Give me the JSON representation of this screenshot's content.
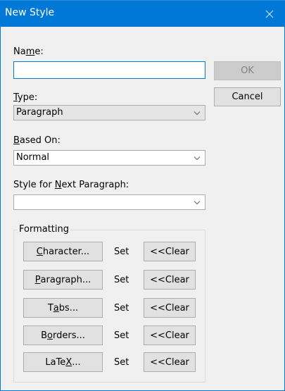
{
  "window": {
    "title": "New Style",
    "close_icon": "close-icon"
  },
  "name": {
    "label_pre": "Na",
    "label_accel": "m",
    "label_post": "e:",
    "value": ""
  },
  "type": {
    "label_pre": "",
    "label_accel": "T",
    "label_post": "ype:",
    "value": "Paragraph"
  },
  "based_on": {
    "label_pre": "",
    "label_accel": "B",
    "label_post": "ased On:",
    "value": "Normal"
  },
  "next_paragraph": {
    "label_pre": "Style for ",
    "label_accel": "N",
    "label_post": "ext Paragraph:",
    "value": ""
  },
  "buttons": {
    "ok": "OK",
    "cancel": "Cancel"
  },
  "formatting": {
    "legend": "Formatting",
    "set_label": "Set",
    "clear_label": "<<Clear",
    "rows": [
      {
        "pre": "",
        "accel": "C",
        "post": "haracter..."
      },
      {
        "pre": "",
        "accel": "P",
        "post": "aragraph..."
      },
      {
        "pre": "T",
        "accel": "a",
        "post": "bs..."
      },
      {
        "pre": "B",
        "accel": "o",
        "post": "rders..."
      },
      {
        "pre": "LaTe",
        "accel": "X",
        "post": "..."
      }
    ]
  },
  "colors": {
    "accent": "#0078d7",
    "dialog_bg": "#f0f0f0",
    "button_bg": "#e1e1e1"
  }
}
